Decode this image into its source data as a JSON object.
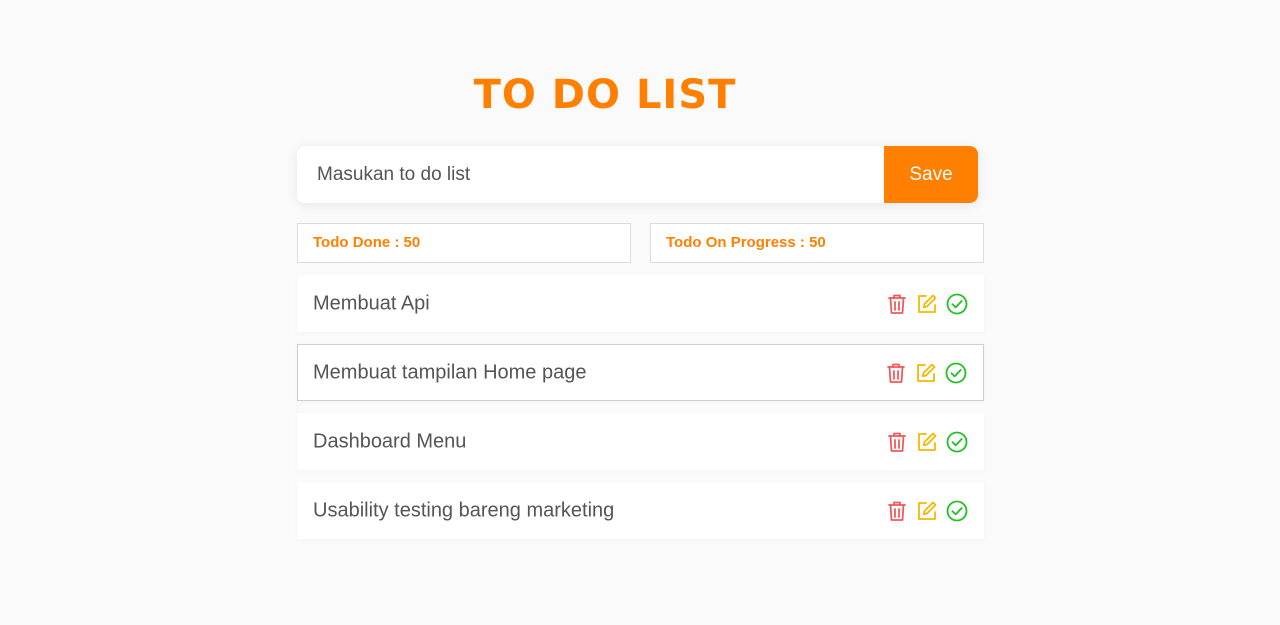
{
  "header": {
    "title": "TO DO LIST"
  },
  "form": {
    "placeholder": "Masukan to do list",
    "value": "",
    "save_label": "Save"
  },
  "stats": {
    "done": "Todo Done : 50",
    "progress": "Todo On Progress : 50"
  },
  "todos": [
    {
      "text": "Membuat Api"
    },
    {
      "text": "Membuat tampilan Home page"
    },
    {
      "text": "Dashboard Menu"
    },
    {
      "text": "Usability testing bareng marketing"
    }
  ],
  "icons": {
    "delete": "trash-icon",
    "edit": "edit-icon",
    "done": "check-circle-icon"
  },
  "colors": {
    "accent": "#ff7f00",
    "delete": "#f05a5a",
    "edit": "#f5b800",
    "done": "#22c022"
  }
}
